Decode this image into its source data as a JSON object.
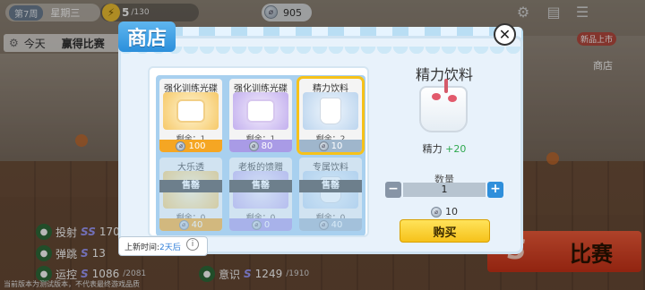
{
  "topbar": {
    "season": "第7周",
    "weekday": "星期三",
    "energy_current": "5",
    "energy_max": "/130",
    "coins": "905"
  },
  "left": {
    "today_label": "今天",
    "today_event": "赢得比赛"
  },
  "stats": [
    {
      "name": "投射",
      "value": "170"
    },
    {
      "name": "弹跳",
      "value": "13"
    },
    {
      "name": "运控",
      "value": "1086",
      "max": "/2081"
    },
    {
      "name": "意识",
      "value": "1249",
      "max": "/1910"
    }
  ],
  "new_badge": {
    "tag": "新品上市",
    "label": "商店"
  },
  "match_button": "比赛",
  "footnote": "当前版本为测试版本，不代表最终游戏品质",
  "shop": {
    "title": "商店",
    "items": [
      {
        "name": "强化训练光碟",
        "remaining": "剩余：1",
        "price": "100",
        "theme": "orange",
        "sold_out": false,
        "selected": false
      },
      {
        "name": "强化训练光碟",
        "remaining": "剩余：1",
        "price": "80",
        "theme": "purple",
        "sold_out": false,
        "selected": false
      },
      {
        "name": "精力饮料",
        "remaining": "剩余：2",
        "price": "10",
        "theme": "blue",
        "sold_out": false,
        "selected": true
      },
      {
        "name": "大乐透",
        "remaining": "剩余：0",
        "price": "40",
        "theme": "orange",
        "sold_out": true,
        "selected": false
      },
      {
        "name": "老板的馈赠",
        "remaining": "剩余：0",
        "price": "0",
        "theme": "purple",
        "sold_out": true,
        "selected": false
      },
      {
        "name": "专属饮料",
        "remaining": "剩余：0",
        "price": "40",
        "theme": "blue",
        "sold_out": true,
        "selected": false
      }
    ],
    "sold_out_label": "售罄",
    "refresh_label": "上新时间:",
    "refresh_value": "2天后",
    "detail": {
      "name": "精力饮料",
      "effect_label": "精力",
      "effect_value": "+20",
      "qty_label": "数量",
      "qty_value": "1",
      "total": "10",
      "buy_label": "购买"
    }
  }
}
